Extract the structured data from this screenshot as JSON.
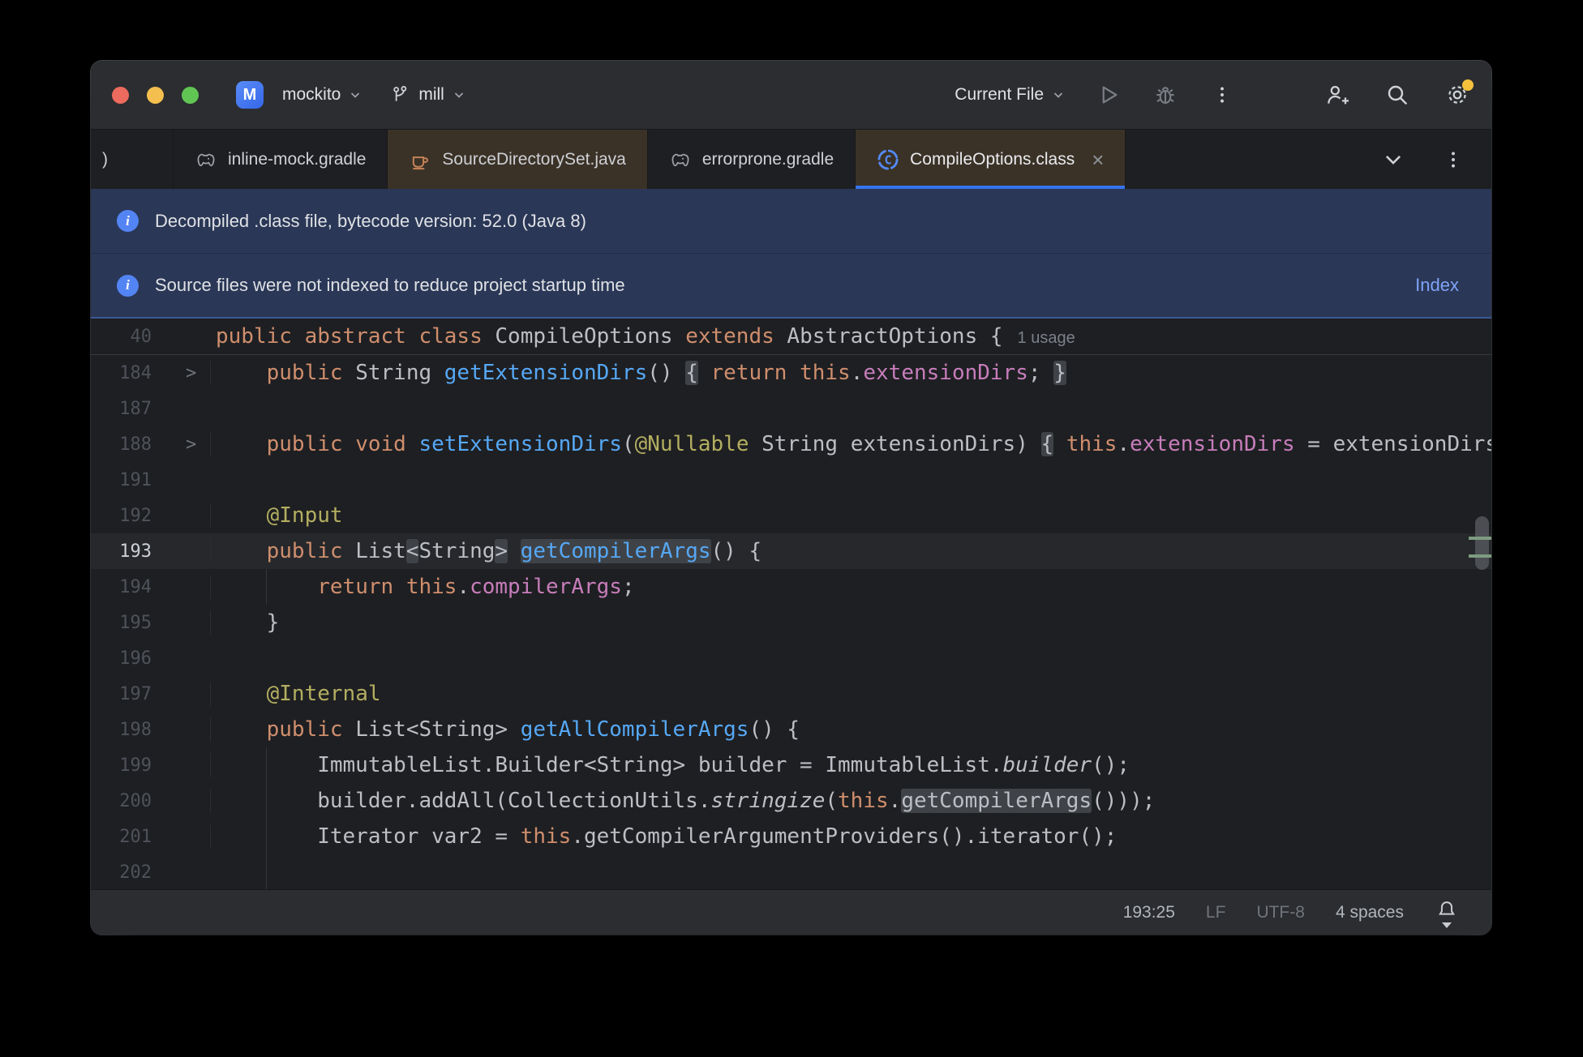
{
  "titlebar": {
    "project": "mockito",
    "project_initial": "M",
    "branch": "mill",
    "run_config": "Current File"
  },
  "tabs": {
    "partial_label": ")",
    "items": [
      {
        "label": "inline-mock.gradle",
        "icon": "gradle-icon"
      },
      {
        "label": "SourceDirectorySet.java",
        "icon": "java-icon"
      },
      {
        "label": "errorprone.gradle",
        "icon": "gradle-icon"
      },
      {
        "label": "CompileOptions.class",
        "icon": "class-icon",
        "active": true,
        "close": "×"
      }
    ]
  },
  "banners": [
    {
      "text": "Decompiled .class file, bytecode version: 52.0 (Java 8)"
    },
    {
      "text": "Source files were not indexed to reduce project startup time",
      "action": "Index"
    }
  ],
  "sticky": {
    "num": "40",
    "tokens": [
      {
        "t": "public abstract class",
        "s": "kw"
      },
      {
        "t": " CompileOptions ",
        "s": "pl"
      },
      {
        "t": "extends",
        "s": "kw"
      },
      {
        "t": " AbstractOptions ",
        "s": "pl"
      },
      {
        "t": "{",
        "s": "pl"
      },
      {
        "t": "1 usage",
        "s": "hint"
      }
    ]
  },
  "editor": {
    "lines": [
      {
        "num": "184",
        "fold": true,
        "tokens": [
          {
            "t": "    ",
            "s": "pl"
          },
          {
            "t": "public",
            "s": "kw"
          },
          {
            "t": " String ",
            "s": "pl"
          },
          {
            "t": "getExtensionDirs",
            "s": "m"
          },
          {
            "t": "() ",
            "s": "pl"
          },
          {
            "t": "{",
            "s": "pl",
            "box": true
          },
          {
            "t": " ",
            "s": "pl"
          },
          {
            "t": "return",
            "s": "kw"
          },
          {
            "t": " ",
            "s": "pl"
          },
          {
            "t": "this",
            "s": "kw"
          },
          {
            "t": ".",
            "s": "pl"
          },
          {
            "t": "extensionDirs",
            "s": "f"
          },
          {
            "t": "; ",
            "s": "pl"
          },
          {
            "t": "}",
            "s": "pl",
            "box": true
          }
        ]
      },
      {
        "num": "187",
        "tokens": []
      },
      {
        "num": "188",
        "fold": true,
        "tokens": [
          {
            "t": "    ",
            "s": "pl"
          },
          {
            "t": "public",
            "s": "kw"
          },
          {
            "t": " ",
            "s": "pl"
          },
          {
            "t": "void",
            "s": "kw"
          },
          {
            "t": " ",
            "s": "pl"
          },
          {
            "t": "setExtensionDirs",
            "s": "m"
          },
          {
            "t": "(",
            "s": "pl"
          },
          {
            "t": "@Nullable",
            "s": "an"
          },
          {
            "t": " String extensionDirs) ",
            "s": "pl"
          },
          {
            "t": "{",
            "s": "pl",
            "box": true
          },
          {
            "t": " ",
            "s": "pl"
          },
          {
            "t": "this",
            "s": "kw"
          },
          {
            "t": ".",
            "s": "pl"
          },
          {
            "t": "extensionDirs",
            "s": "f"
          },
          {
            "t": " = extensionDirs;",
            "s": "pl"
          }
        ]
      },
      {
        "num": "191",
        "tokens": []
      },
      {
        "num": "192",
        "tokens": [
          {
            "t": "    ",
            "s": "pl"
          },
          {
            "t": "@Input",
            "s": "an"
          }
        ]
      },
      {
        "num": "193",
        "current": true,
        "tokens": [
          {
            "t": "    ",
            "s": "pl"
          },
          {
            "t": "public",
            "s": "kw"
          },
          {
            "t": " List",
            "s": "pl"
          },
          {
            "t": "<",
            "s": "pl",
            "box": true
          },
          {
            "t": "String",
            "s": "pl"
          },
          {
            "t": ">",
            "s": "pl",
            "box": true
          },
          {
            "t": " ",
            "s": "pl"
          },
          {
            "t": "getCompilerArgs",
            "s": "m",
            "box": true
          },
          {
            "t": "() {",
            "s": "pl"
          }
        ]
      },
      {
        "num": "194",
        "guide": true,
        "tokens": [
          {
            "t": "        ",
            "s": "pl"
          },
          {
            "t": "return",
            "s": "kw"
          },
          {
            "t": " ",
            "s": "pl"
          },
          {
            "t": "this",
            "s": "kw"
          },
          {
            "t": ".",
            "s": "pl"
          },
          {
            "t": "compilerArgs",
            "s": "f"
          },
          {
            "t": ";",
            "s": "pl"
          }
        ]
      },
      {
        "num": "195",
        "tokens": [
          {
            "t": "    }",
            "s": "pl"
          }
        ]
      },
      {
        "num": "196",
        "tokens": []
      },
      {
        "num": "197",
        "tokens": [
          {
            "t": "    ",
            "s": "pl"
          },
          {
            "t": "@Internal",
            "s": "an"
          }
        ]
      },
      {
        "num": "198",
        "tokens": [
          {
            "t": "    ",
            "s": "pl"
          },
          {
            "t": "public",
            "s": "kw"
          },
          {
            "t": " List<String> ",
            "s": "pl"
          },
          {
            "t": "getAllCompilerArgs",
            "s": "m"
          },
          {
            "t": "() {",
            "s": "pl"
          }
        ]
      },
      {
        "num": "199",
        "guide": true,
        "tokens": [
          {
            "t": "        ImmutableList.Builder<String> builder = ImmutableList.",
            "s": "pl"
          },
          {
            "t": "builder",
            "s": "it"
          },
          {
            "t": "();",
            "s": "pl"
          }
        ]
      },
      {
        "num": "200",
        "guide": true,
        "tokens": [
          {
            "t": "        builder.addAll(CollectionUtils.",
            "s": "pl"
          },
          {
            "t": "stringize",
            "s": "it"
          },
          {
            "t": "(",
            "s": "pl"
          },
          {
            "t": "this",
            "s": "kw"
          },
          {
            "t": ".",
            "s": "pl"
          },
          {
            "t": "getCompilerArgs",
            "s": "pl",
            "box": true
          },
          {
            "t": "()));",
            "s": "pl"
          }
        ]
      },
      {
        "num": "201",
        "guide": true,
        "tokens": [
          {
            "t": "        Iterator var2 = ",
            "s": "pl"
          },
          {
            "t": "this",
            "s": "kw"
          },
          {
            "t": ".getCompilerArgumentProviders().iterator();",
            "s": "pl"
          }
        ]
      },
      {
        "num": "202",
        "guide": true,
        "tokens": []
      }
    ]
  },
  "statusbar": {
    "caret": "193:25",
    "line_ending": "LF",
    "encoding": "UTF-8",
    "indent": "4 spaces"
  },
  "colors": {
    "accent": "#3574f0",
    "keyword": "#cf8e6d",
    "method": "#56a8f5",
    "field": "#c77dbb",
    "annotation": "#b3ae60",
    "banner_bg": "#2a3756",
    "lib_tab_bg": "#3b3227",
    "traffic_red": "#ec6a5e",
    "traffic_yellow": "#f4bf4f",
    "traffic_green": "#61c554",
    "notification_dot": "#f5c13d",
    "scroll_mark_green": "#7e9c80"
  }
}
